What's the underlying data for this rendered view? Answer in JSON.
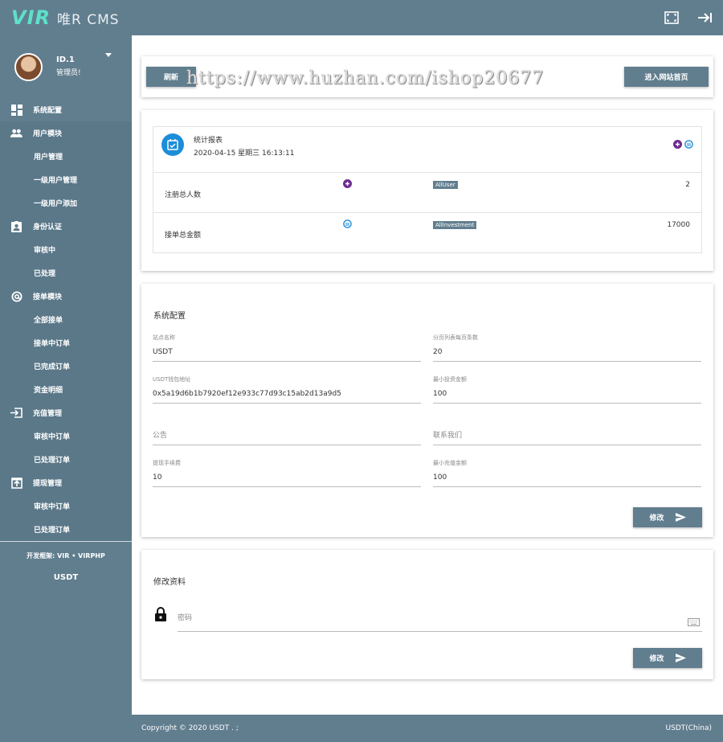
{
  "brand": {
    "logo": "VIR",
    "name": "唯R CMS"
  },
  "topbar": {
    "icons": [
      "fullscreen-icon",
      "logout-icon"
    ]
  },
  "profile": {
    "id": "ID.1",
    "role": "管理员!"
  },
  "sidebar": {
    "groups": [
      {
        "label": "系统配置",
        "icon": "dashboard-icon",
        "items": []
      },
      {
        "label": "用户模块",
        "icon": "people-icon",
        "items": [
          "用户管理",
          "一级用户管理",
          "一级用户添加"
        ]
      },
      {
        "label": "身份认证",
        "icon": "id-badge-icon",
        "items": [
          "审核中",
          "已处理"
        ]
      },
      {
        "label": "接单模块",
        "icon": "at-icon",
        "items": [
          "全部接单",
          "接单中订单",
          "已完成订单",
          "资金明细"
        ]
      },
      {
        "label": "充值管理",
        "icon": "login-box-icon",
        "items": [
          "审核中订单",
          "已处理订单"
        ]
      },
      {
        "label": "提现管理",
        "icon": "upload-box-icon",
        "items": [
          "审核中订单",
          "已处理订单"
        ]
      }
    ],
    "footer": {
      "dev": "开发框架: VIR • VIRPHP",
      "brand": "USDT"
    }
  },
  "toolbar": {
    "refresh": "刷新",
    "home": "进入网站首页",
    "watermark": "https://www.huzhan.com/ishop20677"
  },
  "stats": {
    "title": "统计报表",
    "date": "2020-04-15  星期三 16:13:11",
    "rows": [
      {
        "label": "注册总人数",
        "badge": "AllUser",
        "value": "2"
      },
      {
        "label": "接单总金额",
        "badge": "AllInvestment",
        "value": "17000"
      }
    ]
  },
  "config": {
    "title": "系统配置",
    "fields": [
      {
        "label": "站点名称",
        "value": "USDT"
      },
      {
        "label": "分页列表每页条数",
        "value": "20"
      },
      {
        "label": "USDT钱包地址",
        "value": "0x5a19d6b1b7920ef12e933c77d93c15ab2d13a9d5"
      },
      {
        "label": "最小投资金额",
        "value": "100"
      },
      {
        "label": "",
        "placeholder": "公告"
      },
      {
        "label": "",
        "placeholder": "联系我们"
      },
      {
        "label": "提现手续费",
        "value": "10"
      },
      {
        "label": "最小充值金额",
        "value": "100"
      }
    ],
    "submit": "修改"
  },
  "profile_edit": {
    "title": "修改资料",
    "password_placeholder": "密码",
    "submit": "修改"
  },
  "footer": {
    "copyright": "Copyright © 2020 USDT . ;",
    "region": "USDT(China)"
  },
  "colors": {
    "theme": "#617e8f",
    "accent": "#5fe0c9",
    "calendar": "#1c8dd8"
  }
}
